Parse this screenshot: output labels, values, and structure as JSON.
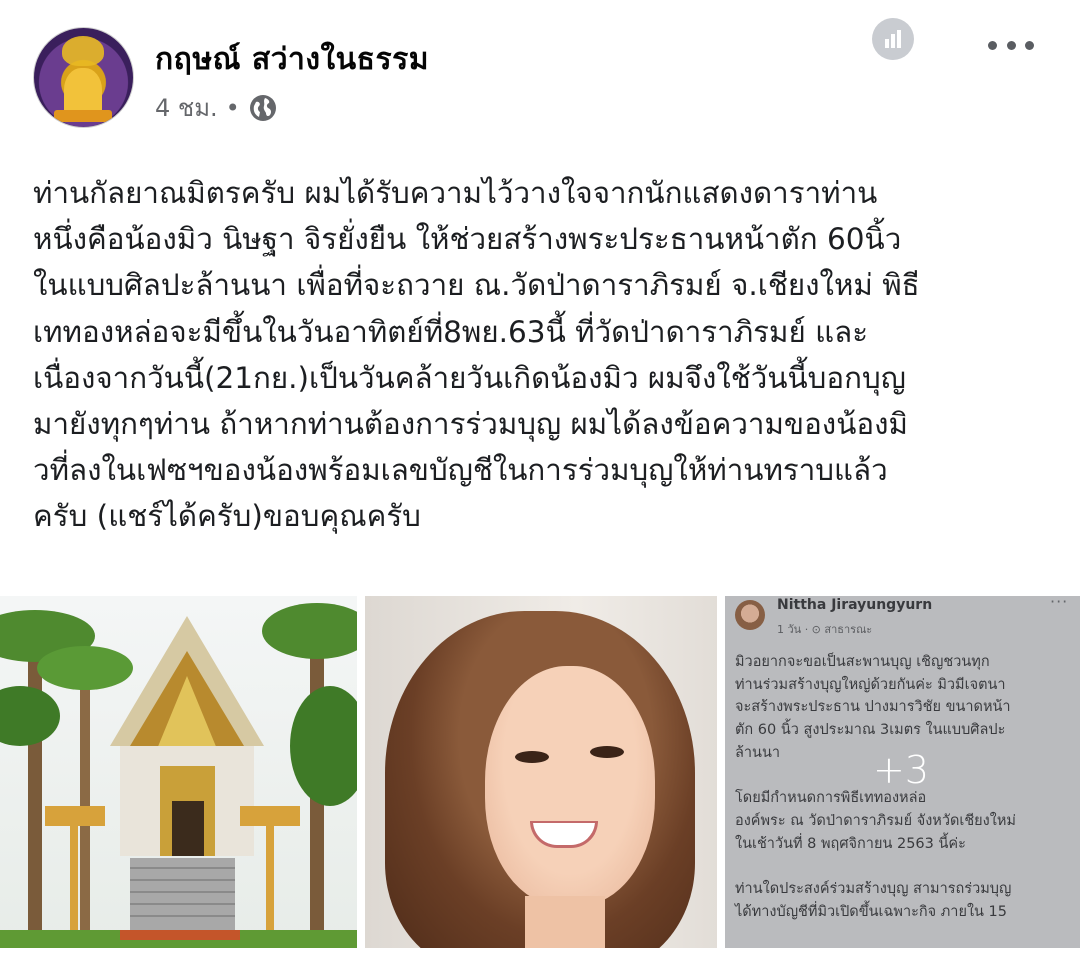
{
  "post": {
    "author": "กฤษณ์ สว่างในธรรม",
    "time": "4 ชม.",
    "separator": "•",
    "privacy_icon": "globe-icon",
    "stats_icon": "bar-chart-icon",
    "menu_icon": "more-dots-icon",
    "body_lines": [
      "ท่านกัลยาณมิตรครับ ผมได้รับความไว้วางใจจากนักแสดงดาราท่าน",
      "หนึ่งคือน้องมิว นิษฐา จิรยั่งยืน ให้ช่วยสร้างพระประธานหน้าตัก 60นิ้ว",
      "ในแบบศิลปะล้านนา เพื่อที่จะถวาย ณ.วัดป่าดาราภิรมย์ จ.เชียงใหม่ พิธี",
      "เททองหล่อจะมีขึ้นในวันอาทิตย์ที่8พย.63นี้ ที่วัดป่าดาราภิรมย์ และ",
      "เนื่องจากวันนี้(21กย.)เป็นวันคล้ายวันเกิดน้องมิว ผมจึงใช้วันนี้บอกบุญ",
      "มายังทุกๆท่าน ถ้าหากท่านต้องการร่วมบุญ ผมได้ลงข้อความของน้องมิ",
      "วที่ลงในเฟซฯของน้องพร้อมเลขบัญชีในการร่วมบุญให้ท่านทราบแล้ว",
      "ครับ (แชร์ได้ครับ)ขอบคุณครับ"
    ]
  },
  "photos": {
    "more_count": "+3",
    "screenshot": {
      "name": "Nittha Jirayungyurn",
      "sub": "1 วัน · ⊙ สาธารณะ",
      "dots": "···",
      "lines": [
        "มิวอยากจะขอเป็นสะพานบุญ เชิญชวนทุก",
        "ท่านร่วมสร้างบุญใหญ่ด้วยกันค่ะ มิวมีเจตนา",
        "จะสร้างพระประธาน ปางมารวิชัย ขนาดหน้า",
        "ตัก 60 นิ้ว สูงประมาณ 3เมตร ในแบบศิลปะ",
        "ล้านนา",
        "",
        "โดยมีกำหนดการพิธีเททองหล่อ",
        "องค์พระ ณ วัดป่าดาราภิรมย์ จังหวัดเชียงใหม่",
        "ในเช้าวันที่ 8 พฤศจิกายน 2563 นี้ค่ะ",
        "",
        "ท่านใดประสงค์ร่วมสร้างบุญ สามารถร่วมบุญ",
        "ได้ทางบัญชีที่มิวเปิดขึ้นเฉพาะกิจ ภายใน 15"
      ]
    }
  }
}
